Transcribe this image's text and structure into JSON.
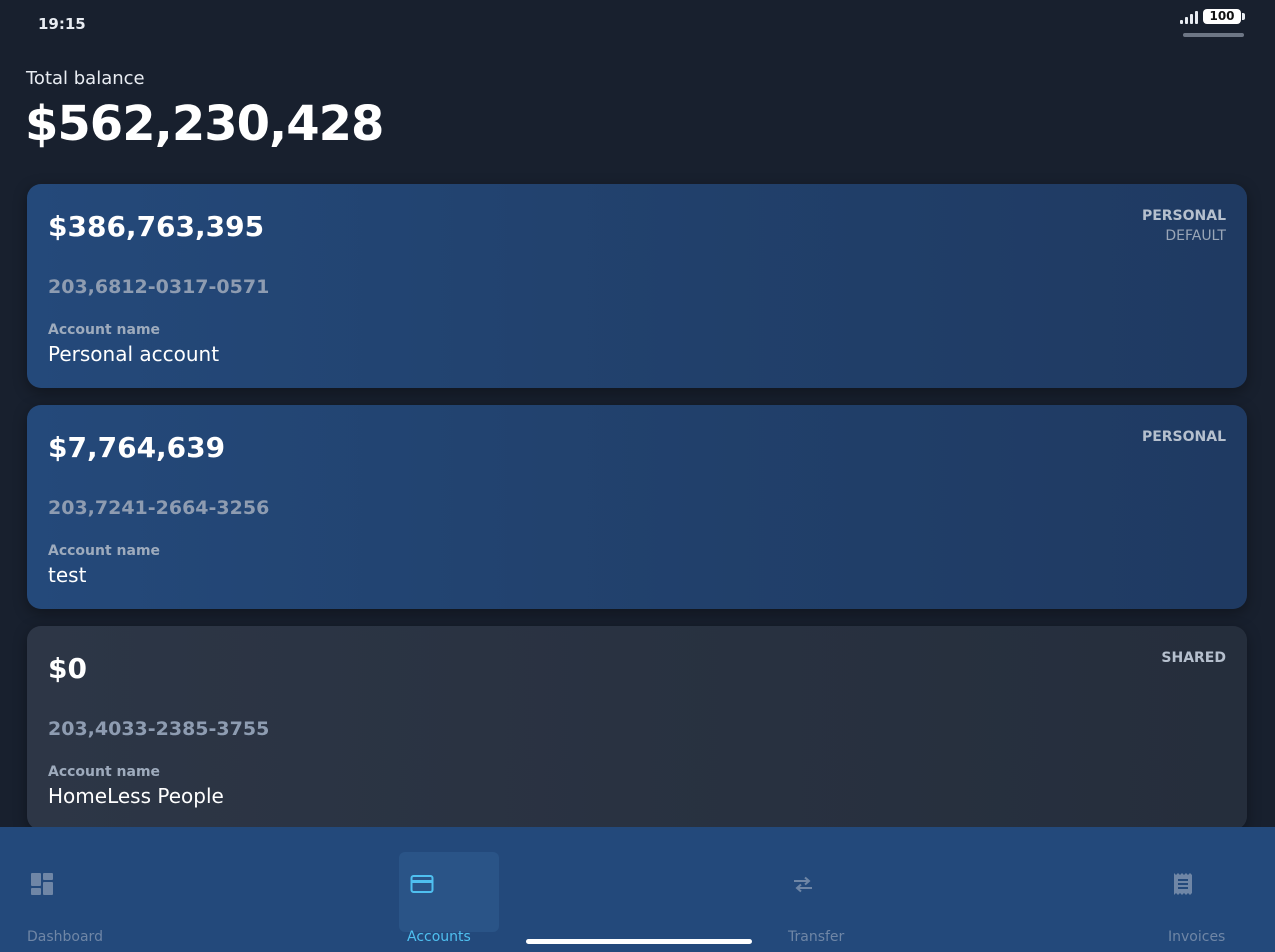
{
  "status_bar": {
    "time": "19:15",
    "battery": "100"
  },
  "summary": {
    "label": "Total balance",
    "value": "$562,230,428"
  },
  "accounts": [
    {
      "balance": "$386,763,395",
      "type": "PERSONAL",
      "tag": "DEFAULT",
      "number": "203,6812-0317-0571",
      "name_label": "Account name",
      "name": "Personal account"
    },
    {
      "balance": "$7,764,639",
      "type": "PERSONAL",
      "tag": "",
      "number": "203,7241-2664-3256",
      "name_label": "Account name",
      "name": "test"
    },
    {
      "balance": "$0",
      "type": "SHARED",
      "tag": "",
      "number": "203,4033-2385-3755",
      "name_label": "Account name",
      "name": "HomeLess People"
    }
  ],
  "nav": {
    "items": [
      {
        "label": "Dashboard",
        "icon": "dashboard-icon"
      },
      {
        "label": "Accounts",
        "icon": "credit-card-icon",
        "active": true
      },
      {
        "label": "Transfer",
        "icon": "transfer-arrows-icon"
      },
      {
        "label": "Invoices",
        "icon": "invoice-icon"
      }
    ]
  },
  "colors": {
    "background": "#18202e",
    "accent": "#4fc0f0",
    "nav_background": "#23497b",
    "card_personal": "#24497a",
    "card_shared": "#2d3646"
  }
}
